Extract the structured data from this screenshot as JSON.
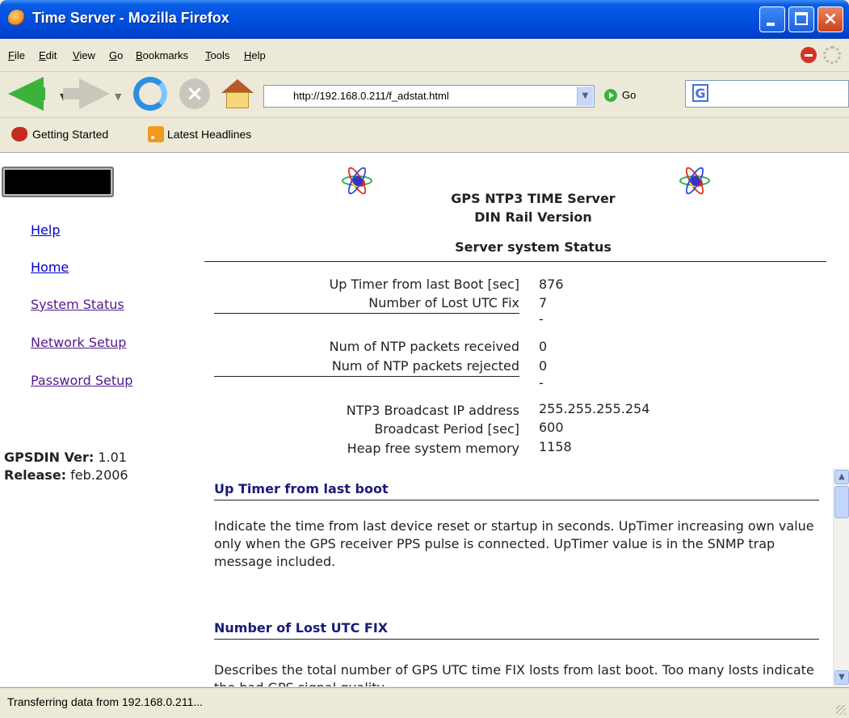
{
  "window": {
    "title": "Time Server - Mozilla Firefox"
  },
  "menu": [
    "File",
    "Edit",
    "View",
    "Go",
    "Bookmarks",
    "Tools",
    "Help"
  ],
  "navbar": {
    "url": "http://192.168.0.211/f_adstat.html",
    "go_label": "Go",
    "search_logo": "G"
  },
  "bookmarks": [
    "Getting Started",
    "Latest Headlines"
  ],
  "sidebar": {
    "links": [
      "Help",
      "Home",
      "System Status",
      "Network Setup",
      "Password Setup"
    ],
    "version_label": "GPSDIN Ver:",
    "version_value": "1.01",
    "release_label": "Release:",
    "release_value": "feb.2006"
  },
  "header": {
    "title_line1": "GPS NTP3 TIME Server",
    "title_line2": "DIN Rail Version",
    "subtitle": "Server system Status"
  },
  "status": {
    "rows": [
      {
        "label": "Up Timer from last Boot [sec]",
        "value": "876"
      },
      {
        "label": "Number of Lost UTC Fix",
        "value": "7"
      },
      {
        "label": "Num of NTP packets received",
        "value": "0"
      },
      {
        "label": "Num of NTP packets rejected",
        "value": "0"
      },
      {
        "label": "NTP3 Broadcast IP address",
        "value": "255.255.255.254"
      },
      {
        "label": "Broadcast Period [sec]",
        "value": "600"
      },
      {
        "label": "Heap free system memory",
        "value": "1158"
      }
    ],
    "separator": "-"
  },
  "help": {
    "sections": [
      {
        "heading": "Up Timer from last boot",
        "body": "Indicate the time from last device reset or startup in seconds. UpTimer increasing own value only when the GPS receiver PPS pulse is connected. UpTimer value is in the SNMP trap message included."
      },
      {
        "heading": "Number of Lost UTC FIX",
        "body": "Describes the total number of GPS UTC time FIX losts from last boot. Too many losts indicate the bad GPS signal quality."
      }
    ]
  },
  "statusbar": {
    "text": "Transferring data from 192.168.0.211..."
  }
}
